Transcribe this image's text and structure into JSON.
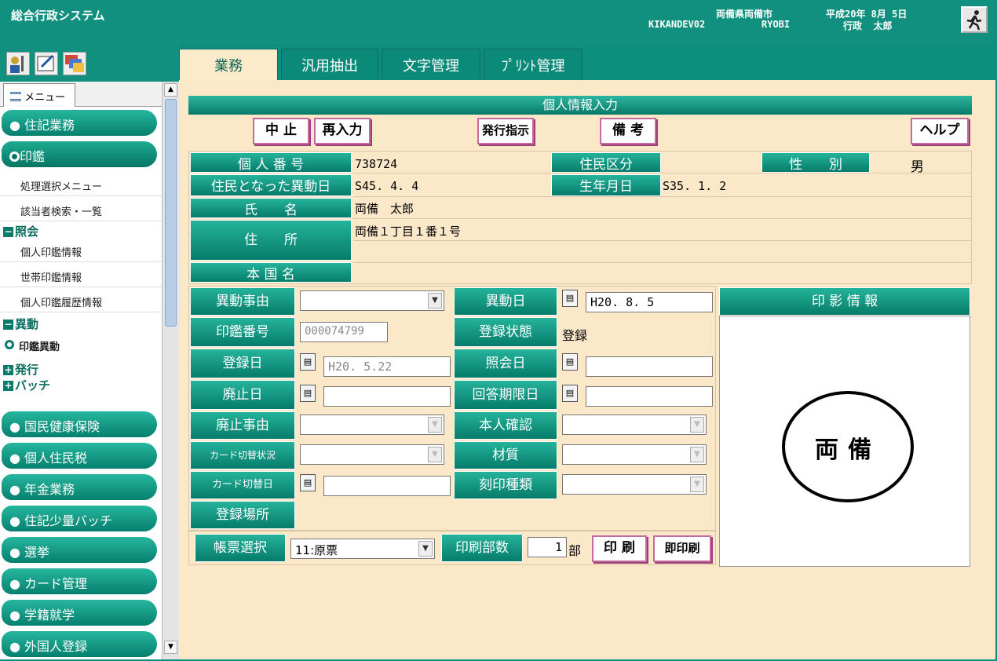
{
  "header": {
    "app_title": "総合行政システム",
    "org_name": "両備県両備市",
    "terminal_id": "KIKANDEV02",
    "user_id": "RYOBI",
    "date": "平成20年 8月 5日",
    "dept_user": "行政  太郎"
  },
  "sidebar": {
    "menu_tab": "メニュー",
    "items": {
      "juki": "● 住記業務",
      "inkan": "印鑑",
      "shori_menu": "処理選択メニュー",
      "gaitousha": "該当者検索・一覧",
      "shokai_group": "照会",
      "kojin_info": "個人印鑑情報",
      "setai_info": "世帯印鑑情報",
      "kojin_history": "個人印鑑履歴情報",
      "idou_group": "異動",
      "inkan_idou": "印鑑異動",
      "hakko_group": "発行",
      "batch_group": "バッチ",
      "kokuho": "● 国民健康保険",
      "kojin_jumin": "● 個人住民税",
      "nenkin": "● 年金業務",
      "juki_batch": "● 住記少量バッチ",
      "senkyo": "● 選挙",
      "card": "● カード管理",
      "gakuseki": "● 学籍就学",
      "gaikokujin": "● 外国人登録"
    }
  },
  "tabs": [
    "業務",
    "汎用抽出",
    "文字管理",
    "ﾌﾟﾘﾝﾄ管理"
  ],
  "form": {
    "title": "個人情報入力",
    "buttons": {
      "cancel": "中 止",
      "reenter": "再入力",
      "issue": "発行指示",
      "remarks": "備 考",
      "help": "ヘルプ"
    },
    "labels": {
      "kojin_bango": "個 人 番 号",
      "jumin_kubun": "住民区分",
      "seibetsu": "性　　別",
      "jumin_date": "住民となった異動日",
      "birth": "生年月日",
      "name": "氏　　名",
      "address": "住　　所",
      "honseki": "本 国 名",
      "idou_jiyu": "異動事由",
      "idou_date": "異動日",
      "inkan_no": "印鑑番号",
      "toroku_status": "登録状態",
      "toroku_date": "登録日",
      "shokai_date": "照会日",
      "haishi_date": "廃止日",
      "kaito_kigen": "回答期限日",
      "haishi_jiyu": "廃止事由",
      "honnin_kakunin": "本人確認",
      "card_status": "カード切替状況",
      "zaishitsu": "材質",
      "card_date": "カード切替日",
      "kokuin_shurui": "刻印種類",
      "toroku_basho": "登録場所",
      "inei_info": "印 影 情 報"
    },
    "values": {
      "kojin_bango": "738724",
      "seibetsu": "男",
      "jumin_date": "S45. 4. 4",
      "birth": "S35. 1. 2",
      "name": "両備　太郎",
      "address": "両備１丁目１番１号",
      "idou_date": "H20. 8. 5",
      "inkan_no": "000074799",
      "toroku_status": "登録",
      "toroku_date": "H20. 5.22"
    },
    "footer": {
      "chohyo_label": "帳票選択",
      "chohyo_value": "11:原票",
      "busu_label": "印刷部数",
      "busu_value": "1",
      "busu_unit": "部",
      "print": "印 刷",
      "quick_print": "即印刷"
    },
    "seal_text": "両備"
  }
}
